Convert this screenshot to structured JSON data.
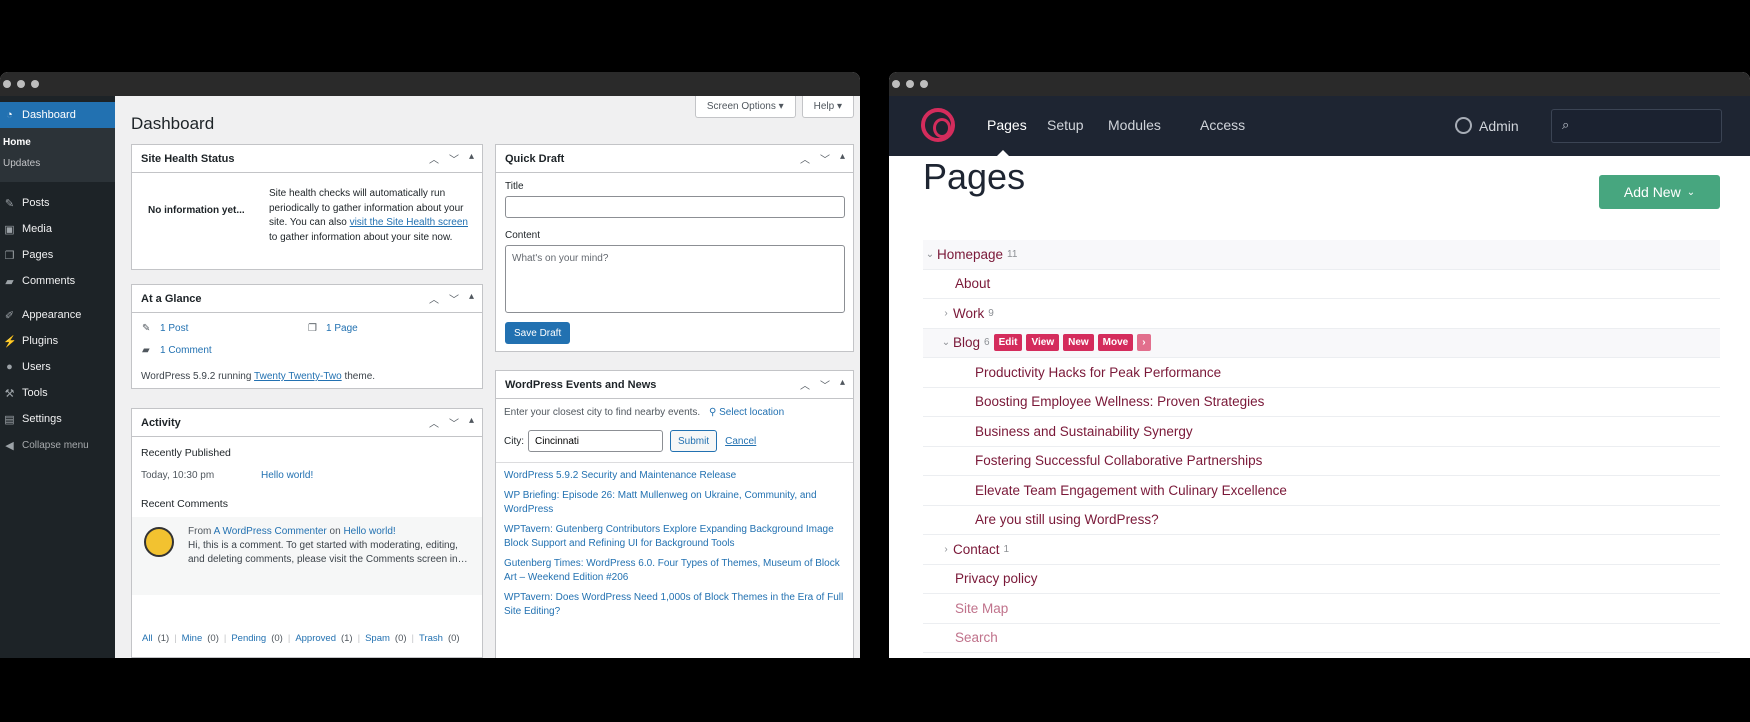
{
  "wp": {
    "sidebar": {
      "dashboard": "Dashboard",
      "sub": [
        "Home",
        "Updates"
      ],
      "items": [
        "Posts",
        "Media",
        "Pages",
        "Comments"
      ],
      "items2": [
        "Appearance",
        "Plugins",
        "Users",
        "Tools",
        "Settings"
      ],
      "collapse": "Collapse menu"
    },
    "screen_options": "Screen Options ▾",
    "help": "Help ▾",
    "title": "Dashboard",
    "site_health": {
      "title": "Site Health Status",
      "status": "No information yet...",
      "desc1": "Site health checks will automatically run periodically to gather information about your site. You can also",
      "link": "visit the Site Health screen",
      "desc2": "to gather information about your site now."
    },
    "glance": {
      "title": "At a Glance",
      "posts": "1 Post",
      "pages": "1 Page",
      "comments": "1 Comment",
      "ver1": "WordPress 5.9.2 running",
      "theme": "Twenty Twenty-Two",
      "ver2": "theme."
    },
    "activity": {
      "title": "Activity",
      "recent_pub": "Recently Published",
      "date": "Today, 10:30 pm",
      "post": "Hello world!",
      "recent_comments": "Recent Comments",
      "from": "From",
      "author": "A WordPress Commenter",
      "on": "on",
      "post2": "Hello world!",
      "excerpt": "Hi, this is a comment. To get started with moderating, editing, and deleting comments, please visit the Comments screen in…",
      "filters": [
        {
          "l": "All",
          "c": "(1)"
        },
        {
          "l": "Mine",
          "c": "(0)"
        },
        {
          "l": "Pending",
          "c": "(0)"
        },
        {
          "l": "Approved",
          "c": "(1)"
        },
        {
          "l": "Spam",
          "c": "(0)"
        },
        {
          "l": "Trash",
          "c": "(0)"
        }
      ]
    },
    "quick_draft": {
      "title": "Quick Draft",
      "title_label": "Title",
      "content_label": "Content",
      "placeholder": "What's on your mind?",
      "save": "Save Draft"
    },
    "events": {
      "title": "WordPress Events and News",
      "intro": "Enter your closest city to find nearby events.",
      "select": "Select location",
      "city_label": "City:",
      "city": "Cincinnati",
      "submit": "Submit",
      "cancel": "Cancel",
      "news": [
        "WordPress 5.9.2 Security and Maintenance Release",
        "WP Briefing: Episode 26: Matt Mullenweg on Ukraine, Community, and WordPress",
        "WPTavern: Gutenberg Contributors Explore Expanding Background Image Block Support and Refining UI for Background Tools",
        "Gutenberg Times: WordPress 6.0. Four Types of Themes, Museum of Block Art – Weekend Edition #206",
        "WPTavern: Does WordPress Need 1,000s of Block Themes in the Era of Full Site Editing?"
      ]
    }
  },
  "pw": {
    "nav": [
      "Pages",
      "Setup",
      "Modules",
      "Access"
    ],
    "admin": "Admin",
    "title": "Pages",
    "add_new": "Add New",
    "tree": [
      {
        "label": "Homepage",
        "count": "11",
        "level": 0,
        "chev": "⌄"
      },
      {
        "label": "About",
        "count": "",
        "level": 1,
        "chev": ""
      },
      {
        "label": "Work",
        "count": "9",
        "level": 1,
        "chev": "›"
      },
      {
        "label": "Blog",
        "count": "6",
        "level": 1,
        "chev": "⌄"
      },
      {
        "label": "Productivity Hacks for Peak Performance",
        "count": "",
        "level": 2,
        "chev": ""
      },
      {
        "label": "Boosting Employee Wellness: Proven Strategies",
        "count": "",
        "level": 2,
        "chev": ""
      },
      {
        "label": "Business and Sustainability Synergy",
        "count": "",
        "level": 2,
        "chev": ""
      },
      {
        "label": "Fostering Successful Collaborative Partnerships",
        "count": "",
        "level": 2,
        "chev": ""
      },
      {
        "label": "Elevate Team Engagement with Culinary Excellence",
        "count": "",
        "level": 2,
        "chev": ""
      },
      {
        "label": "Are you still using WordPress?",
        "count": "",
        "level": 2,
        "chev": ""
      },
      {
        "label": "Contact",
        "count": "1",
        "level": 1,
        "chev": "›"
      },
      {
        "label": "Privacy policy",
        "count": "",
        "level": 1,
        "chev": ""
      },
      {
        "label": "Site Map",
        "count": "",
        "level": 1,
        "chev": ""
      },
      {
        "label": "Search",
        "count": "",
        "level": 1,
        "chev": ""
      }
    ],
    "actions": [
      "Edit",
      "View",
      "New",
      "Move",
      "›"
    ]
  }
}
